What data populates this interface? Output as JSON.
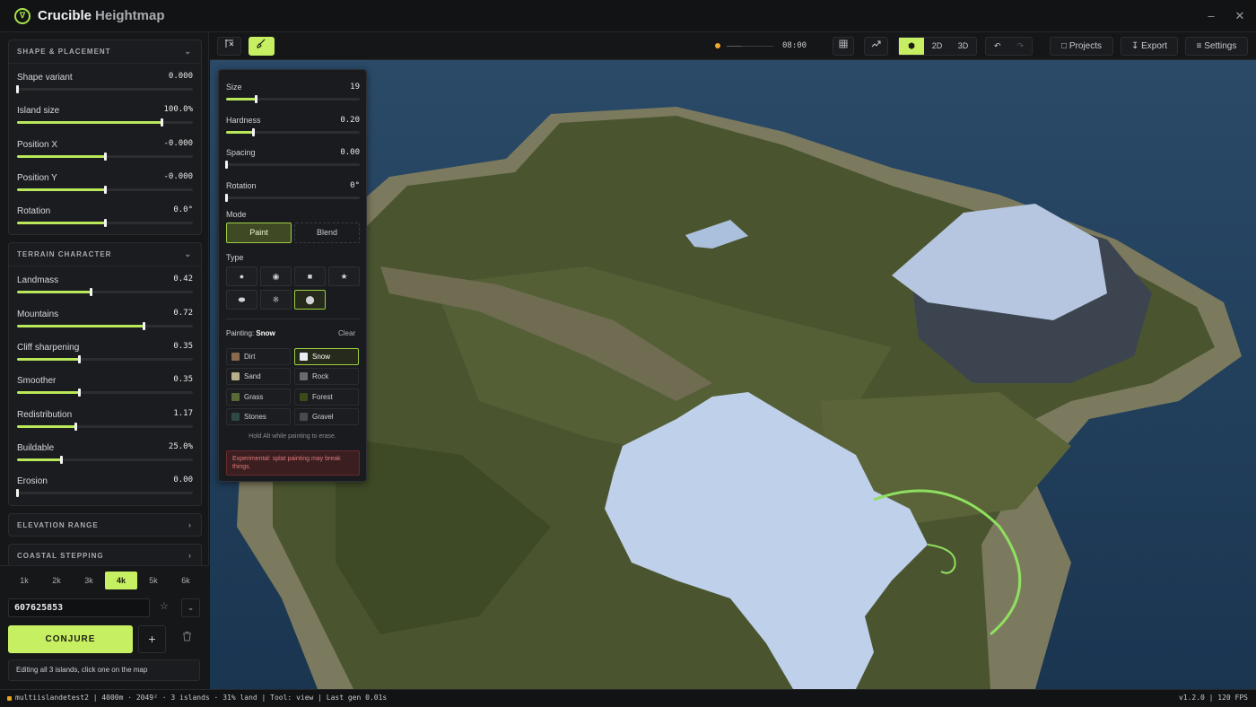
{
  "app": {
    "title_main": "Crucible",
    "title_sub": "Heightmap",
    "logo_glyph": "∇"
  },
  "window": {
    "minimize": "–",
    "close": "✕"
  },
  "colors": {
    "accent": "#c6f062",
    "water": "#22415c",
    "grass": "#4a5530",
    "snow": "#c0d0ea"
  },
  "sidebar": {
    "shape": {
      "title": "SHAPE & PLACEMENT",
      "sliders": [
        {
          "label": "Shape variant",
          "value": "0.000",
          "fraction": 0.0
        },
        {
          "label": "Island size",
          "value": "100.0%",
          "fraction": 0.82
        },
        {
          "label": "Position X",
          "value": "-0.000",
          "fraction": 0.5
        },
        {
          "label": "Position Y",
          "value": "-0.000",
          "fraction": 0.5
        },
        {
          "label": "Rotation",
          "value": "0.0°",
          "fraction": 0.5
        }
      ]
    },
    "terrain": {
      "title": "TERRAIN CHARACTER",
      "sliders": [
        {
          "label": "Landmass",
          "value": "0.42",
          "fraction": 0.42
        },
        {
          "label": "Mountains",
          "value": "0.72",
          "fraction": 0.72
        },
        {
          "label": "Cliff sharpening",
          "value": "0.35",
          "fraction": 0.35
        },
        {
          "label": "Smoother",
          "value": "0.35",
          "fraction": 0.35
        },
        {
          "label": "Redistribution",
          "value": "1.17",
          "fraction": 0.33
        },
        {
          "label": "Buildable",
          "value": "25.0%",
          "fraction": 0.25
        },
        {
          "label": "Erosion",
          "value": "0.00",
          "fraction": 0.0
        }
      ]
    },
    "elevation_title": "ELEVATION RANGE",
    "coastal_title": "COASTAL STEPPING",
    "resolutions": [
      "1k",
      "2k",
      "3k",
      "4k",
      "5k",
      "6k"
    ],
    "resolution_selected": "4k",
    "seed": "607625853",
    "conjure_label": "CONJURE",
    "plus_label": "+",
    "hint": "Editing all 3 islands, click one on the map"
  },
  "toolbar": {
    "time": "08:00",
    "time_fraction": 0.33,
    "view_2d": "2D",
    "view_3d": "3D",
    "projects": "Projects",
    "export": "Export",
    "settings": "Settings"
  },
  "brush": {
    "sliders": [
      {
        "label": "Size",
        "value": "19",
        "fraction": 0.22
      },
      {
        "label": "Hardness",
        "value": "0.20",
        "fraction": 0.2
      },
      {
        "label": "Spacing",
        "value": "0.00",
        "fraction": 0.0
      },
      {
        "label": "Rotation",
        "value": "0°",
        "fraction": 0.0
      }
    ],
    "mode_label": "Mode",
    "mode_paint": "Paint",
    "mode_blend": "Blend",
    "type_label": "Type",
    "painting_prefix": "Painting:",
    "painting_value": "Snow",
    "clear_label": "Clear",
    "materials": [
      {
        "name": "Dirt",
        "color": "#8a6a4e"
      },
      {
        "name": "Snow",
        "color": "#e8eef5"
      },
      {
        "name": "Sand",
        "color": "#b8b08a"
      },
      {
        "name": "Rock",
        "color": "#6a6a6a"
      },
      {
        "name": "Grass",
        "color": "#5a6a34"
      },
      {
        "name": "Forest",
        "color": "#3a4a1a"
      },
      {
        "name": "Stones",
        "color": "#2e4a44"
      },
      {
        "name": "Gravel",
        "color": "#4a4a4a"
      }
    ],
    "alt_hint": "Hold Alt while painting to erase.",
    "warning": "Experimental: splat painting may break things."
  },
  "status": {
    "left": "multiislandetest2 | 4000m · 2049² · 3 islands · 31% land | Tool: view | Last gen 0.01s",
    "right": "v1.2.0 | 120 FPS"
  }
}
